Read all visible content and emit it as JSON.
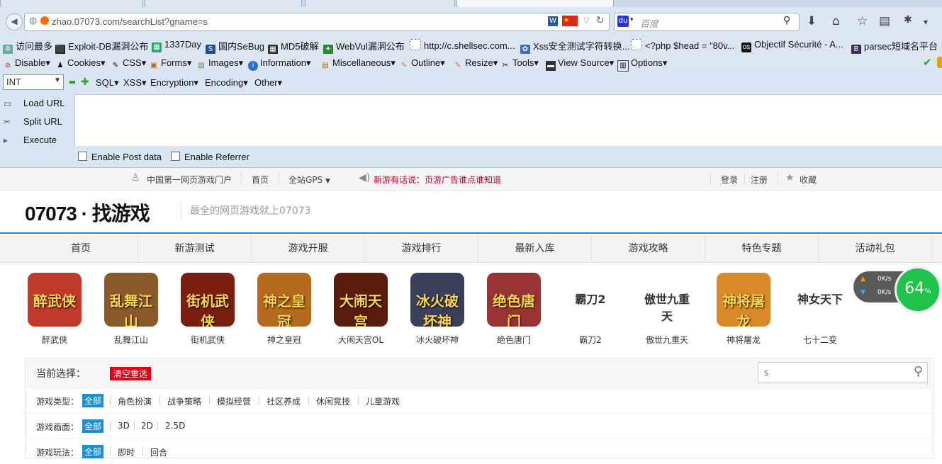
{
  "browser": {
    "url": "zhao.07073.com/searchList?gname=s",
    "search_placeholder": "百度"
  },
  "bookmarks": [
    "访问最多",
    "Exploit-DB漏洞公布",
    "1337Day",
    "国内SeBug",
    "MD5破解",
    "WebVul漏洞公布",
    "http://c.shellsec.com...",
    "Xss安全测试字符转换...",
    "<?php $head = \"80v...",
    "Objectif Sécurité - A...",
    "parsec短域名平台"
  ],
  "webdev": [
    "Disable",
    "Cookies",
    "CSS",
    "Forms",
    "Images",
    "Information",
    "Miscellaneous",
    "Outline",
    "Resize",
    "Tools",
    "View Source",
    "Options"
  ],
  "hackbar": {
    "select_value": "INT",
    "menus": [
      "SQL",
      "XSS",
      "Encryption",
      "Encoding",
      "Other"
    ],
    "actions": [
      "Load URL",
      "Split URL",
      "Execute"
    ],
    "checks": [
      "Enable Post data",
      "Enable Referrer"
    ]
  },
  "site": {
    "topbar": {
      "portal": "中国第一网页游戏门户",
      "home": "首页",
      "gps": "全站GPS",
      "notice": "新游有话说：页游广告谁点谁知道",
      "login": "登录",
      "register": "注册",
      "favorite": "收藏"
    },
    "logo": "07073 · 找游戏",
    "slogan": "最全的网页游戏就上07073",
    "nav": [
      "首页",
      "新游测试",
      "游戏开服",
      "游戏排行",
      "最新入库",
      "游戏攻略",
      "特色专题",
      "活动礼包"
    ],
    "games": [
      {
        "name": "醉武侠",
        "thumb": "醉武侠",
        "color": "#c0392b"
      },
      {
        "name": "乱舞江山",
        "thumb": "乱舞江山",
        "color": "#8b5a2b"
      },
      {
        "name": "街机武侠",
        "thumb": "街机武侠",
        "color": "#7a1f10"
      },
      {
        "name": "神之皇冠",
        "thumb": "神之皇冠",
        "color": "#b36a1c"
      },
      {
        "name": "大闹天宫OL",
        "thumb": "大闹天宫",
        "color": "#5a1c0c"
      },
      {
        "name": "冰火破坏神",
        "thumb": "冰火破坏神",
        "color": "#3a3f5a"
      },
      {
        "name": "绝色唐门",
        "thumb": "绝色唐门",
        "color": "#9a3434"
      },
      {
        "name": "霸刀2",
        "thumb": "霸刀2",
        "color": "#ffffff"
      },
      {
        "name": "傲世九重天",
        "thumb": "傲世九重天",
        "color": "#ffffff"
      },
      {
        "name": "神将屠龙",
        "thumb": "神将屠龙",
        "color": "#d88a2a"
      },
      {
        "name": "七十二变",
        "thumb": "神女天下",
        "color": "#ffffff"
      }
    ],
    "widget": {
      "up": "0K/s",
      "down": "0K/s",
      "percent": "64"
    },
    "filter": {
      "current_label": "当前选择：",
      "clear": "清空重选",
      "search_value": "s",
      "rows": [
        {
          "label": "游戏类型：",
          "selected": "全部",
          "options": [
            "角色扮演",
            "战争策略",
            "模拟经营",
            "社区养成",
            "休闲竞技",
            "儿童游戏"
          ]
        },
        {
          "label": "游戏画面：",
          "selected": "全部",
          "options": [
            "3D",
            "2D",
            "2.5D"
          ]
        },
        {
          "label": "游戏玩法：",
          "selected": "全部",
          "options": [
            "即时",
            "回合"
          ]
        }
      ]
    }
  }
}
